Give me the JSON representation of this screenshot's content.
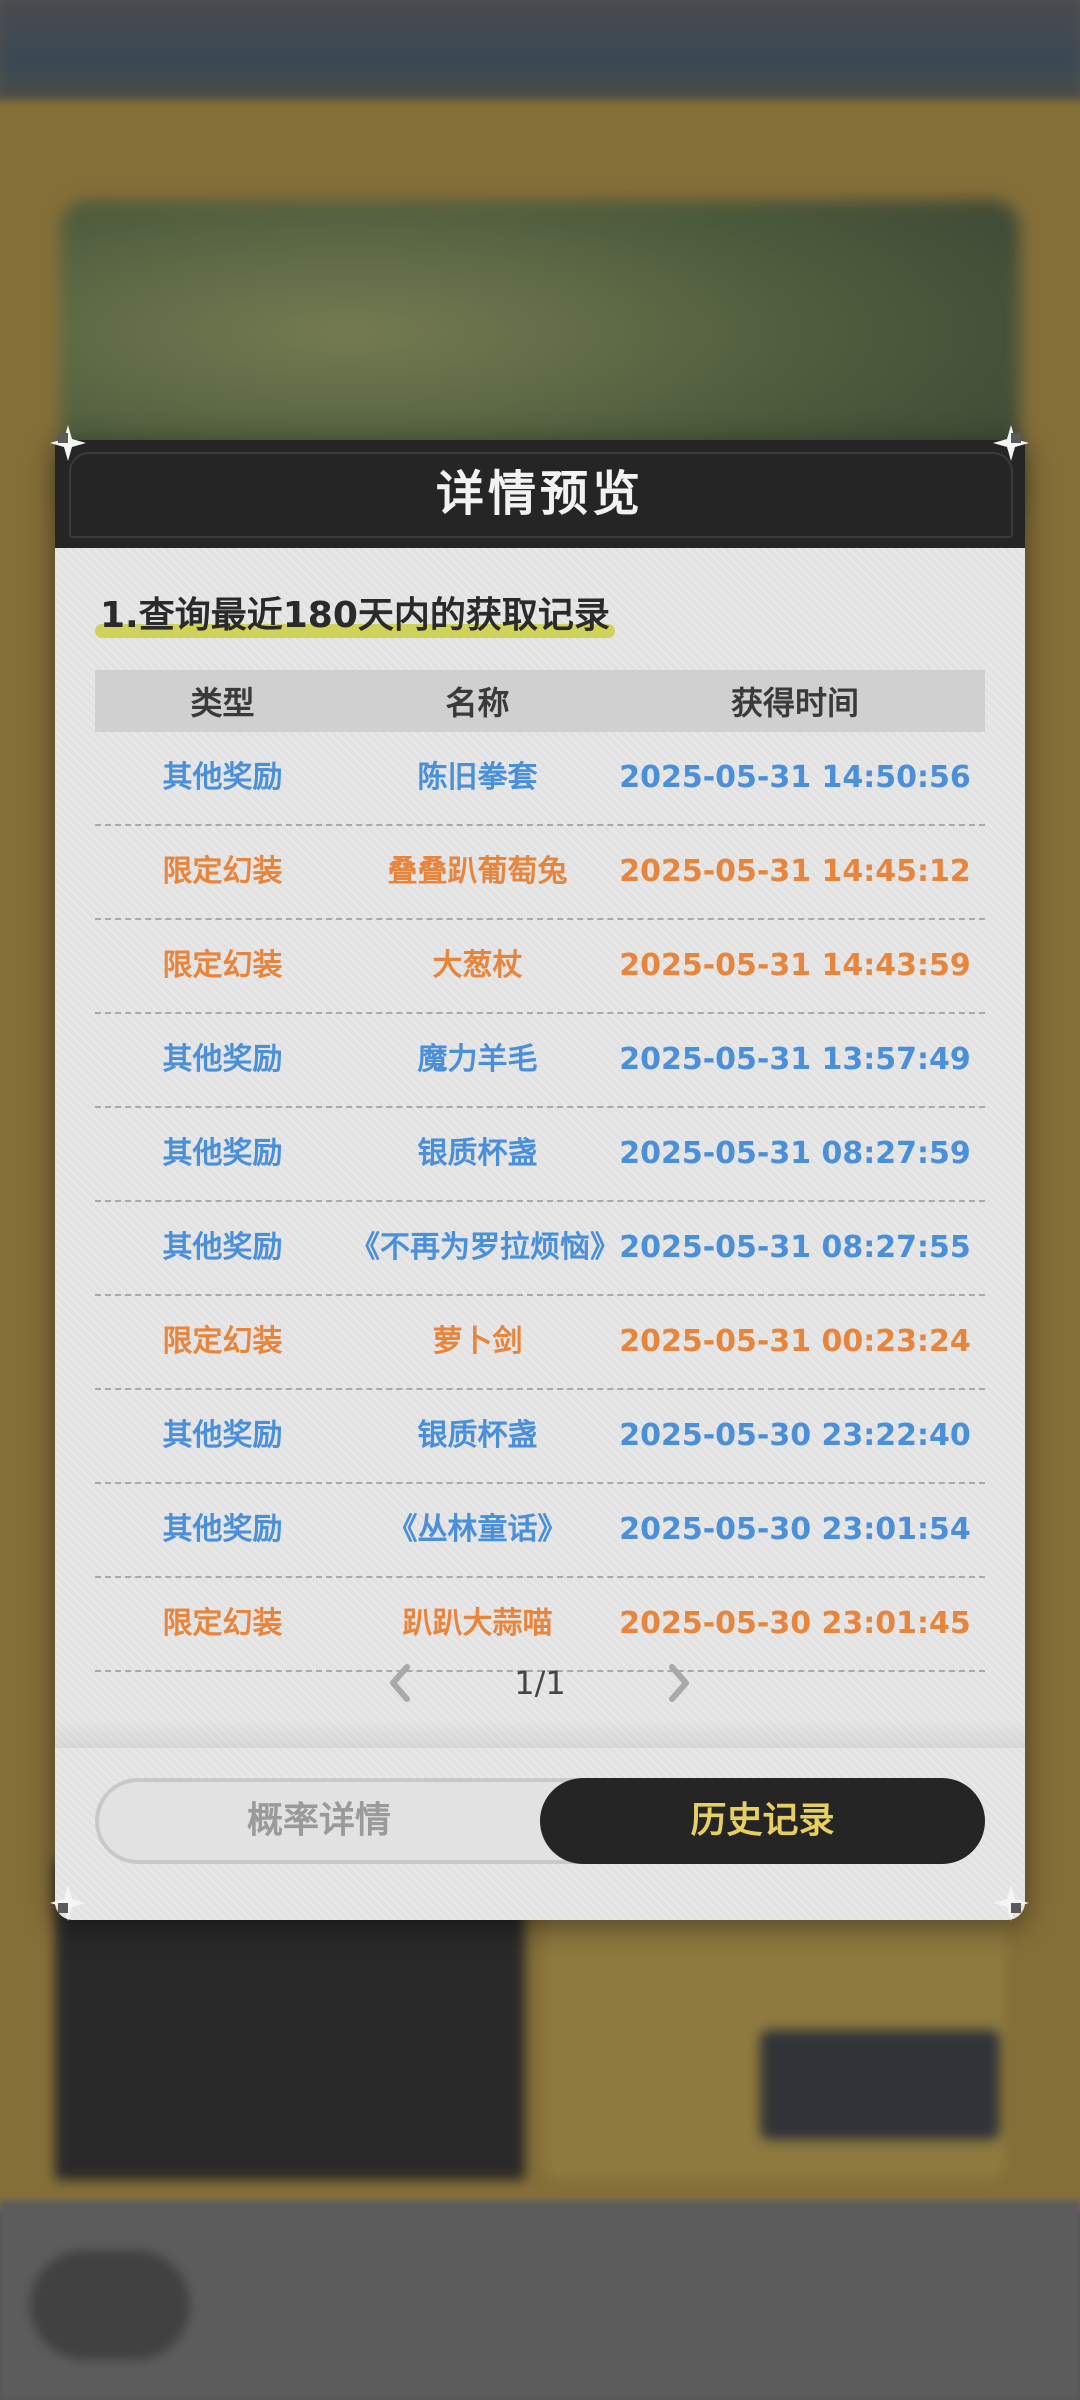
{
  "modal": {
    "title": "详情预览",
    "section_heading": "1.查询最近180天内的获取记录",
    "table": {
      "headers": [
        "类型",
        "名称",
        "获得时间"
      ],
      "rows": [
        {
          "type": "其他奖励",
          "name": "陈旧拳套",
          "time": "2025-05-31 14:50:56",
          "category": "other"
        },
        {
          "type": "限定幻装",
          "name": "叠叠趴葡萄兔",
          "time": "2025-05-31 14:45:12",
          "category": "limited"
        },
        {
          "type": "限定幻装",
          "name": "大葱杖",
          "time": "2025-05-31 14:43:59",
          "category": "limited"
        },
        {
          "type": "其他奖励",
          "name": "魔力羊毛",
          "time": "2025-05-31 13:57:49",
          "category": "other"
        },
        {
          "type": "其他奖励",
          "name": "银质杯盏",
          "time": "2025-05-31 08:27:59",
          "category": "other"
        },
        {
          "type": "其他奖励",
          "name": "《不再为罗拉烦恼》",
          "time": "2025-05-31 08:27:55",
          "category": "other"
        },
        {
          "type": "限定幻装",
          "name": "萝卜剑",
          "time": "2025-05-31 00:23:24",
          "category": "limited"
        },
        {
          "type": "其他奖励",
          "name": "银质杯盏",
          "time": "2025-05-30 23:22:40",
          "category": "other"
        },
        {
          "type": "其他奖励",
          "name": "《丛林童话》",
          "time": "2025-05-30 23:01:54",
          "category": "other"
        },
        {
          "type": "限定幻装",
          "name": "趴趴大蒜喵",
          "time": "2025-05-30 23:01:45",
          "category": "limited"
        }
      ]
    },
    "pager": {
      "text": "1/1",
      "prev_icon": "chevron-left-icon",
      "next_icon": "chevron-right-icon"
    },
    "tabs": {
      "left_label": "概率详情",
      "right_label": "历史记录",
      "active": "历史记录"
    }
  },
  "colors": {
    "other_reward": "#4a8fd9",
    "limited_costume": "#e8853d",
    "header_bg": "#252525",
    "active_tab_text": "#e8d060",
    "heading_highlight": "#cfd35a"
  }
}
